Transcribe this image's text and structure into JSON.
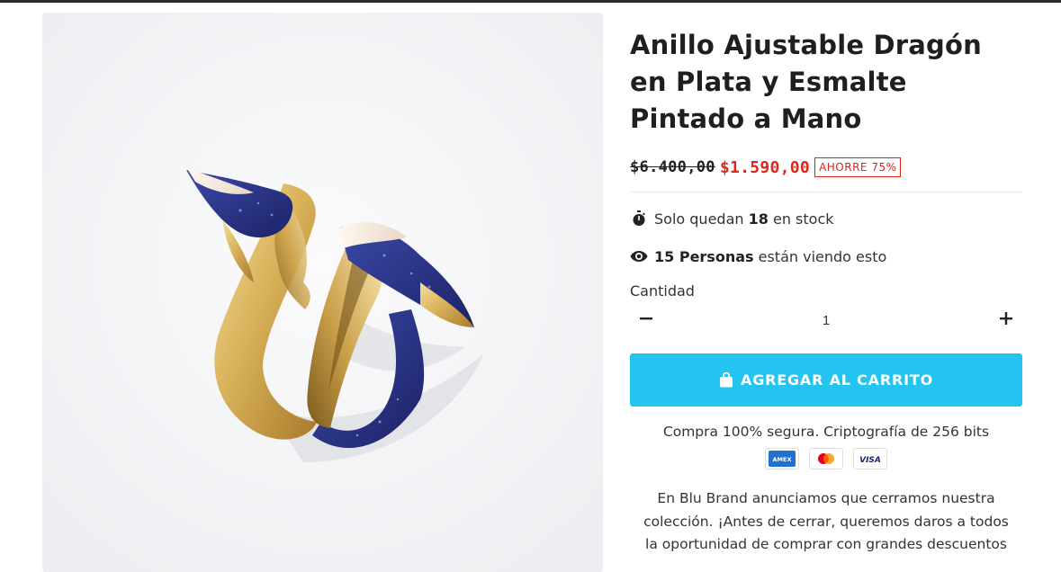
{
  "product": {
    "title_lines": [
      "Anillo Ajustable Dragón",
      "en Plata y Esmalte",
      "Pintado a Mano"
    ],
    "image_alt": "Anillo dragón dorado con esmalte azul"
  },
  "pricing": {
    "compare_at": "$6.400,00",
    "price": "$1.590,00",
    "savings_badge": "AHORRE 75%"
  },
  "stock": {
    "prefix": "Solo quedan",
    "count": "18",
    "suffix": "en stock",
    "icon": "stopwatch-icon"
  },
  "viewers": {
    "count_text": "15 Personas",
    "suffix": "están viendo esto",
    "icon": "eye-icon"
  },
  "quantity": {
    "label": "Cantidad",
    "value": "1",
    "decrement_icon": "minus-icon",
    "increment_icon": "plus-icon"
  },
  "cart": {
    "button_label": "AGREGAR AL CARRITO",
    "icon": "shopping-bag-icon"
  },
  "security": {
    "text": "Compra 100% segura. Criptografía de 256 bits",
    "cards": [
      "AMEX",
      "MASTERCARD",
      "VISA"
    ]
  },
  "description": {
    "lines": [
      "En Blu Brand anunciamos que cerramos nuestra",
      "colección. ¡Antes de cerrar, queremos daros a todos",
      "la oportunidad de comprar con grandes descuentos"
    ]
  },
  "colors": {
    "accent_button": "#23c4f0",
    "sale_red": "#e1251b",
    "text_dark": "#1f1f1f"
  }
}
